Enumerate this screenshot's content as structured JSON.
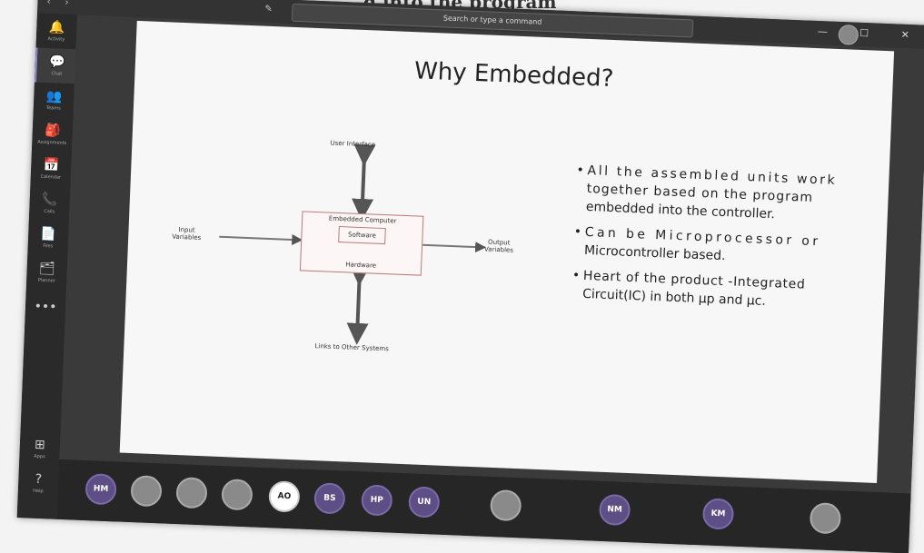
{
  "background": {
    "top_text": "d into the program"
  },
  "window": {
    "nav_arrows": "‹ ›",
    "compose": "✎",
    "search_placeholder": "Search or type a command",
    "controls": "— ☐ ✕"
  },
  "rail": {
    "items": [
      {
        "label": "Activity",
        "glyph": "🔔"
      },
      {
        "label": "Chat",
        "glyph": "💬"
      },
      {
        "label": "Teams",
        "glyph": "👥"
      },
      {
        "label": "Assignments",
        "glyph": "🎒"
      },
      {
        "label": "Calendar",
        "glyph": "📅"
      },
      {
        "label": "Calls",
        "glyph": "📞"
      },
      {
        "label": "Files",
        "glyph": "📄"
      },
      {
        "label": "Planner",
        "glyph": "🗂"
      },
      {
        "label": "",
        "glyph": "•••"
      }
    ],
    "bottom": [
      {
        "label": "Apps",
        "glyph": "⊞"
      },
      {
        "label": "Help",
        "glyph": "?"
      }
    ]
  },
  "slide": {
    "title": "Why Embedded?",
    "diagram": {
      "user_interface": "User Interface",
      "input": "Input\nVariables",
      "output": "Output\nVariables",
      "box_top": "Embedded Computer",
      "software": "Software",
      "hardware": "Hardware",
      "links": "Links to Other Systems"
    },
    "bullets": [
      {
        "l1": "All the assembled units work",
        "l2": "together based on the program",
        "l3": "embedded into the controller."
      },
      {
        "l1": "Can be Microprocessor or",
        "l2": "Microcontroller based."
      },
      {
        "l1": "Heart of the product -Integrated",
        "l2": "Circuit(IC) in both μp and μc."
      }
    ]
  },
  "participants": [
    {
      "initials": "HM",
      "style": "normal"
    },
    {
      "initials": "",
      "style": "photo"
    },
    {
      "initials": "",
      "style": "photo"
    },
    {
      "initials": "",
      "style": "photo"
    },
    {
      "initials": "AO",
      "style": "white"
    },
    {
      "initials": "BS",
      "style": "normal"
    },
    {
      "initials": "HP",
      "style": "normal"
    },
    {
      "initials": "UN",
      "style": "normal"
    },
    {
      "initials": "",
      "style": "photo"
    },
    {
      "initials": "NM",
      "style": "normal"
    },
    {
      "initials": "KM",
      "style": "normal"
    },
    {
      "initials": "",
      "style": "photo"
    }
  ],
  "colors": {
    "accent": "#5e4e86",
    "rail": "#2a2a2a",
    "slide_bg": "#f7f7f7"
  }
}
